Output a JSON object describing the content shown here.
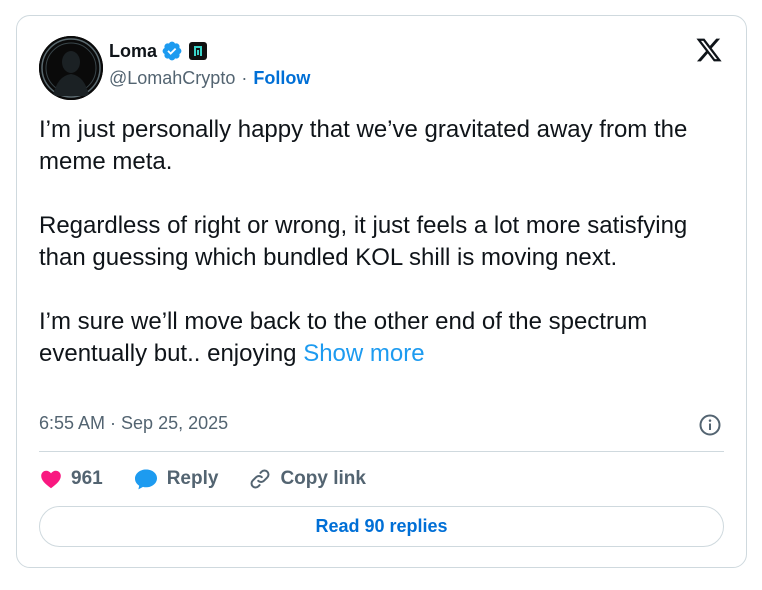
{
  "author": {
    "name": "Loma",
    "handle": "@LomahCrypto",
    "separator": "·",
    "follow_label": "Follow"
  },
  "tweet": {
    "paragraphs": [
      "I’m just personally happy that we’ve gravitated away from the meme meta.",
      "Regardless of right or wrong, it just feels a lot more satisfying than guessing which bundled KOL shill is moving next."
    ],
    "last_paragraph": "I’m sure we’ll move back to the other end of the spectrum eventually but.. enjoying ",
    "show_more_label": "Show more",
    "timestamp": "6:55 AM · Sep 25, 2025"
  },
  "actions": {
    "likes_count": "961",
    "reply_label": "Reply",
    "copy_link_label": "Copy link"
  },
  "read_replies_label": "Read 90 replies",
  "colors": {
    "link": "#006fd6",
    "show_more": "#1d9bf0",
    "like": "#f91880",
    "verified": "#1d9bf0",
    "muted": "#536471",
    "border": "#cfd9de"
  },
  "icons": {
    "brand": "x-logo-icon",
    "verified": "verified-badge-icon",
    "affiliate": "affiliate-badge-icon",
    "info": "info-icon",
    "like": "heart-icon",
    "reply": "reply-bubble-icon",
    "copy": "link-icon"
  }
}
